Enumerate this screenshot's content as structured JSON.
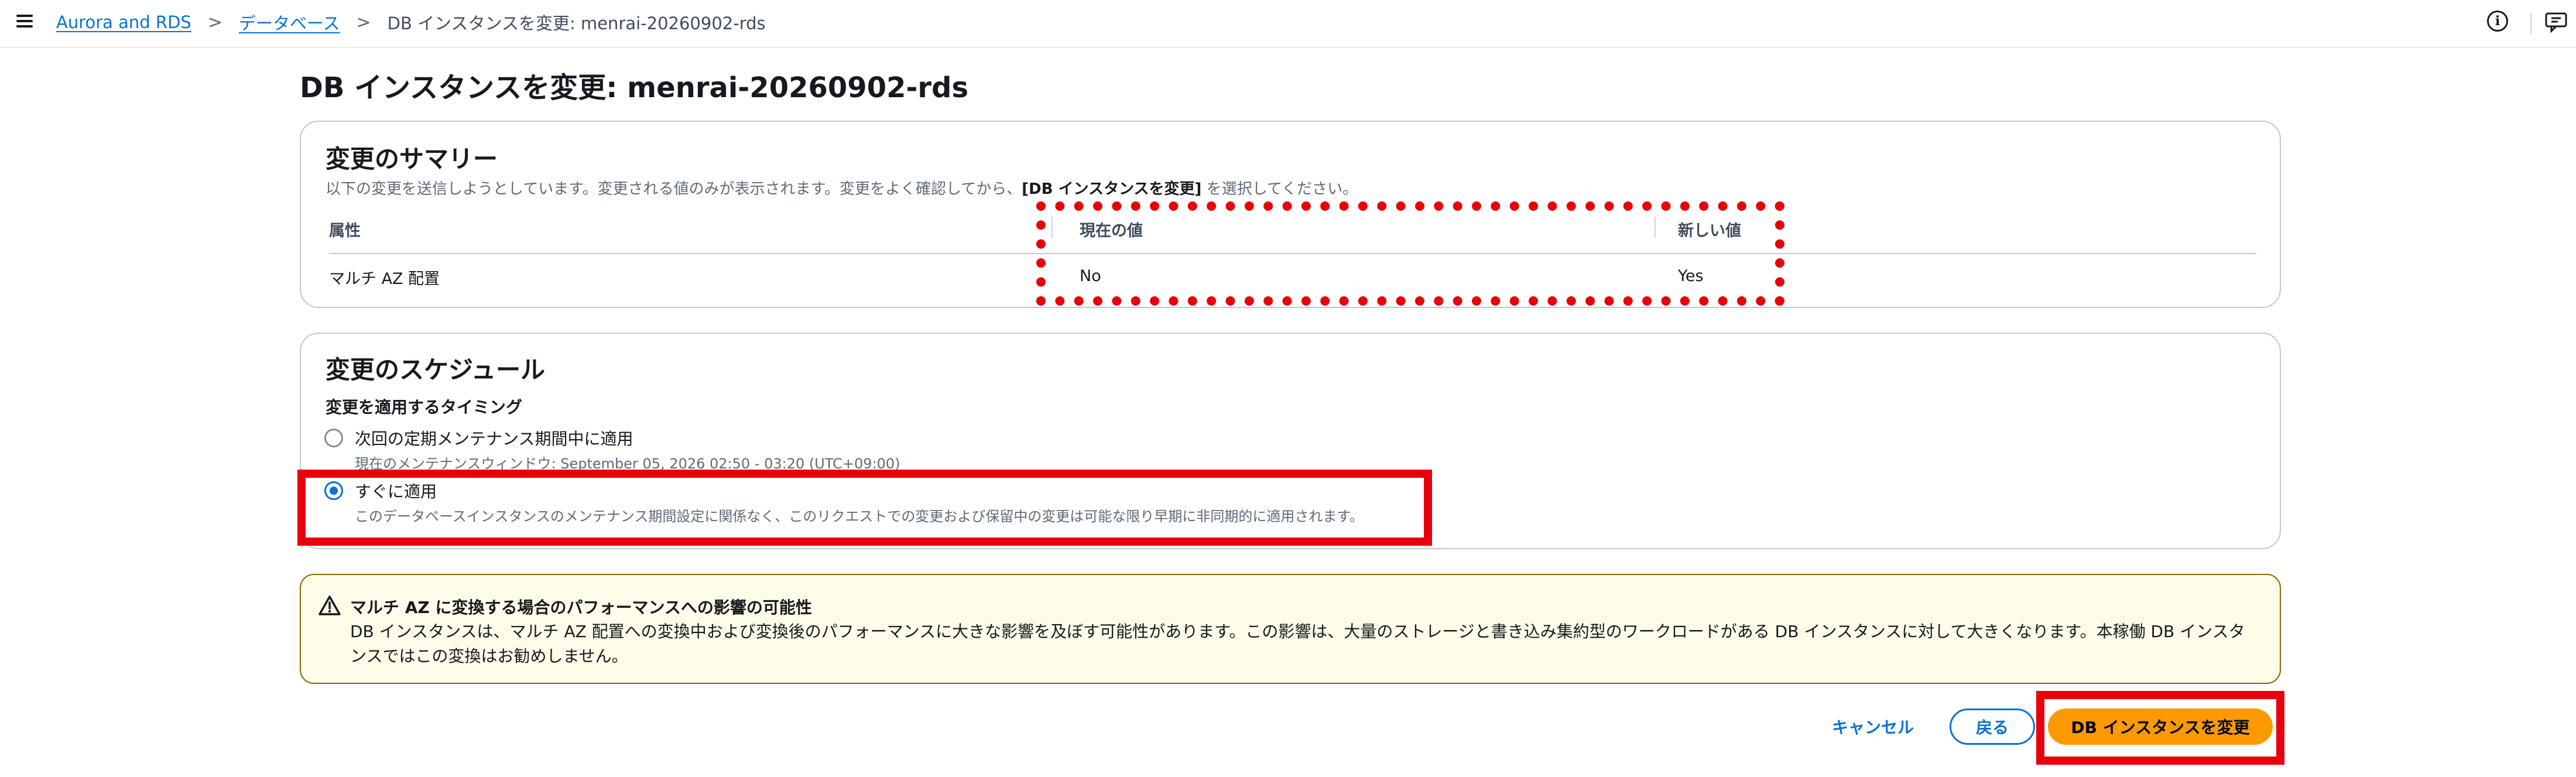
{
  "topbar": {
    "menu_icon": "hamburger-menu-icon",
    "breadcrumbs": [
      "Aurora and RDS",
      "データベース",
      "DB インスタンスを変更: menrai-20260902-rds"
    ],
    "separator": ">",
    "info_icon": "info-icon",
    "feedback_icon": "feedback-icon"
  },
  "page": {
    "title": "DB インスタンスを変更: menrai-20260902-rds"
  },
  "summary": {
    "title": "変更のサマリー",
    "description_prefix": "以下の変更を送信しようとしています。変更される値のみが表示されます。変更をよく確認してから、",
    "description_bold": "[DB インスタンスを変更]",
    "description_suffix": " を選択してください。",
    "columns": [
      "属性",
      "現在の値",
      "新しい値"
    ],
    "rows": [
      {
        "attribute": "マルチ AZ 配置",
        "current": "No",
        "new": "Yes"
      }
    ]
  },
  "schedule": {
    "title": "変更のスケジュール",
    "timing_label": "変更を適用するタイミング",
    "options": [
      {
        "label": "次回の定期メンテナンス期間中に適用",
        "description": "現在のメンテナンスウィンドウ: September 05, 2026 02:50 - 03:20 (UTC+09:00)",
        "selected": false
      },
      {
        "label": "すぐに適用",
        "description": "このデータベースインスタンスのメンテナンス期間設定に関係なく、このリクエストでの変更および保留中の変更は可能な限り早期に非同期的に適用されます。",
        "selected": true
      }
    ]
  },
  "alert": {
    "icon": "warning-icon",
    "title": "マルチ AZ に変換する場合のパフォーマンスへの影響の可能性",
    "body": "DB インスタンスは、マルチ AZ 配置への変換中および変換後のパフォーマンスに大きな影響を及ぼす可能性があります。この影響は、大量のストレージと書き込み集約型のワークロードがある DB インスタンスに対して大きくなります。本稼働 DB インスタンスではこの変換はお勧めしません。"
  },
  "actions": {
    "cancel": "キャンセル",
    "back": "戻る",
    "submit": "DB インスタンスを変更"
  },
  "colors": {
    "link": "#0972d3",
    "primary_button": "#ff9900",
    "highlight": "#e8000b",
    "alert_background": "#fffce9",
    "alert_border": "#8d6605"
  }
}
